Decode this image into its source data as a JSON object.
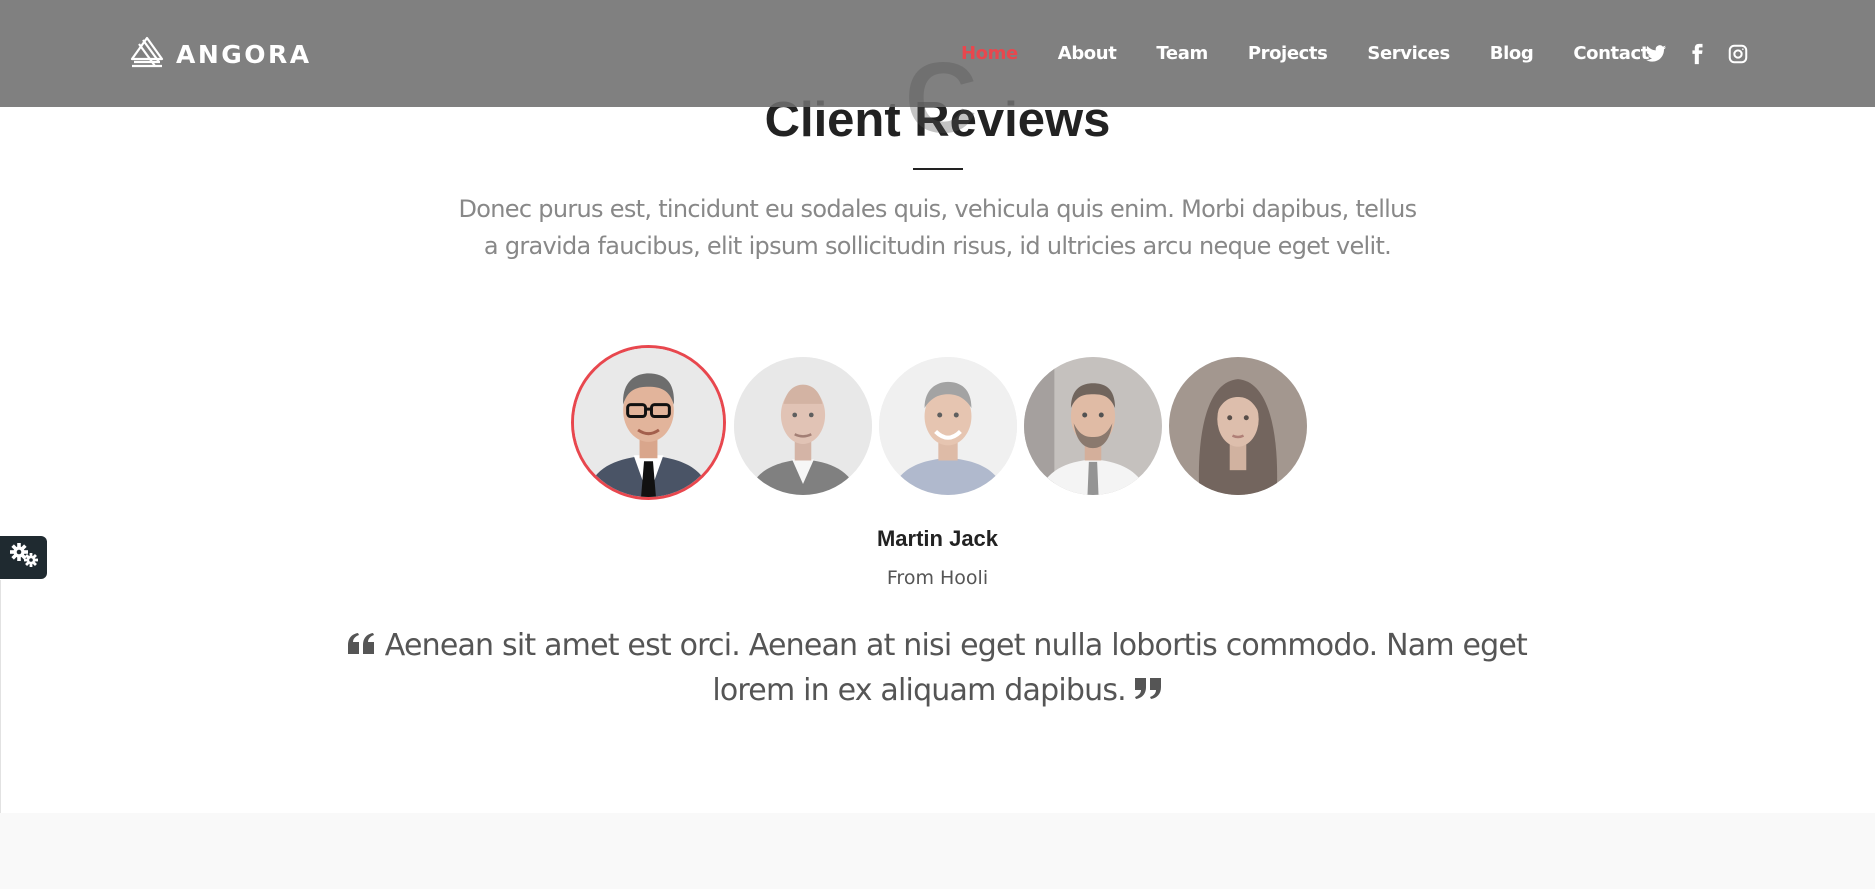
{
  "brand": {
    "name": "ANGORA",
    "icon": "angora-logo-icon"
  },
  "nav": {
    "items": [
      {
        "label": "Home",
        "active": true
      },
      {
        "label": "About",
        "active": false
      },
      {
        "label": "Team",
        "active": false
      },
      {
        "label": "Projects",
        "active": false
      },
      {
        "label": "Services",
        "active": false
      },
      {
        "label": "Blog",
        "active": false
      },
      {
        "label": "Contact",
        "active": false
      }
    ]
  },
  "social": [
    "twitter-icon",
    "facebook-icon",
    "instagram-icon"
  ],
  "section": {
    "ghost_letter": "C",
    "title": "Client Reviews",
    "description": "Donec purus est, tincidunt eu sodales quis, vehicula quis enim. Morbi dapibus, tellus a gravida faucibus, elit ipsum sollicitudin risus, id ultricies arcu neque eget velit."
  },
  "testimonials": {
    "avatars": [
      "man-glasses-portrait",
      "bald-man-portrait",
      "smiling-man-portrait",
      "bearded-man-portrait",
      "woman-portrait"
    ],
    "active_index": 0,
    "active": {
      "name": "Martin Jack",
      "company": "From Hooli",
      "quote": "Aenean sit amet est orci. Aenean at nisi eget nulla lobortis commodo. Nam eget lorem in ex aliquam dapibus."
    }
  },
  "colors": {
    "accent": "#e8474e",
    "header_bg": "#6e6e6e",
    "text_dark": "#222222",
    "text_muted": "#888888",
    "settings_bg": "#1f2a30"
  }
}
